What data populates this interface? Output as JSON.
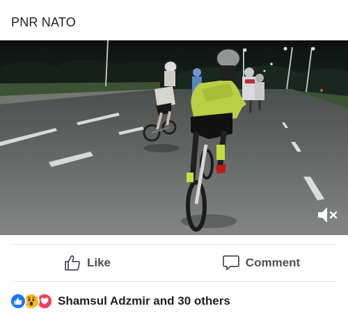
{
  "post": {
    "title": "PNR NATO"
  },
  "video": {
    "muted": true,
    "mute_icon": "speaker-muted-icon"
  },
  "actions": {
    "like_label": "Like",
    "like_icon": "thumbs-up-icon",
    "comment_label": "Comment",
    "comment_icon": "speech-bubble-icon"
  },
  "reactions": {
    "icons": [
      "like-reaction-icon",
      "wow-reaction-icon",
      "love-reaction-icon"
    ],
    "summary": "Shamsul Adzmir and 30 others"
  },
  "colors": {
    "like_blue": "#1877f2",
    "wow_yellow": "#f7b928",
    "love_red": "#f33e58",
    "action_gray": "#4b4f56"
  }
}
